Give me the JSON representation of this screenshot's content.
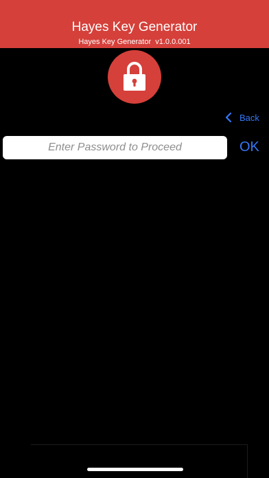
{
  "header": {
    "title": "Hayes Key Generator",
    "version_line": "Hayes Key Generator  v1.0.0.001",
    "background_color": "#d5403a"
  },
  "lock": {
    "icon": "padlock-icon",
    "circle_color": "#d5403a"
  },
  "navigation": {
    "back_label": "Back",
    "back_icon": "chevron-left-icon",
    "accent_color": "#3478f6"
  },
  "password": {
    "value": "",
    "placeholder": "Enter Password to Proceed"
  },
  "actions": {
    "ok_label": "OK"
  }
}
